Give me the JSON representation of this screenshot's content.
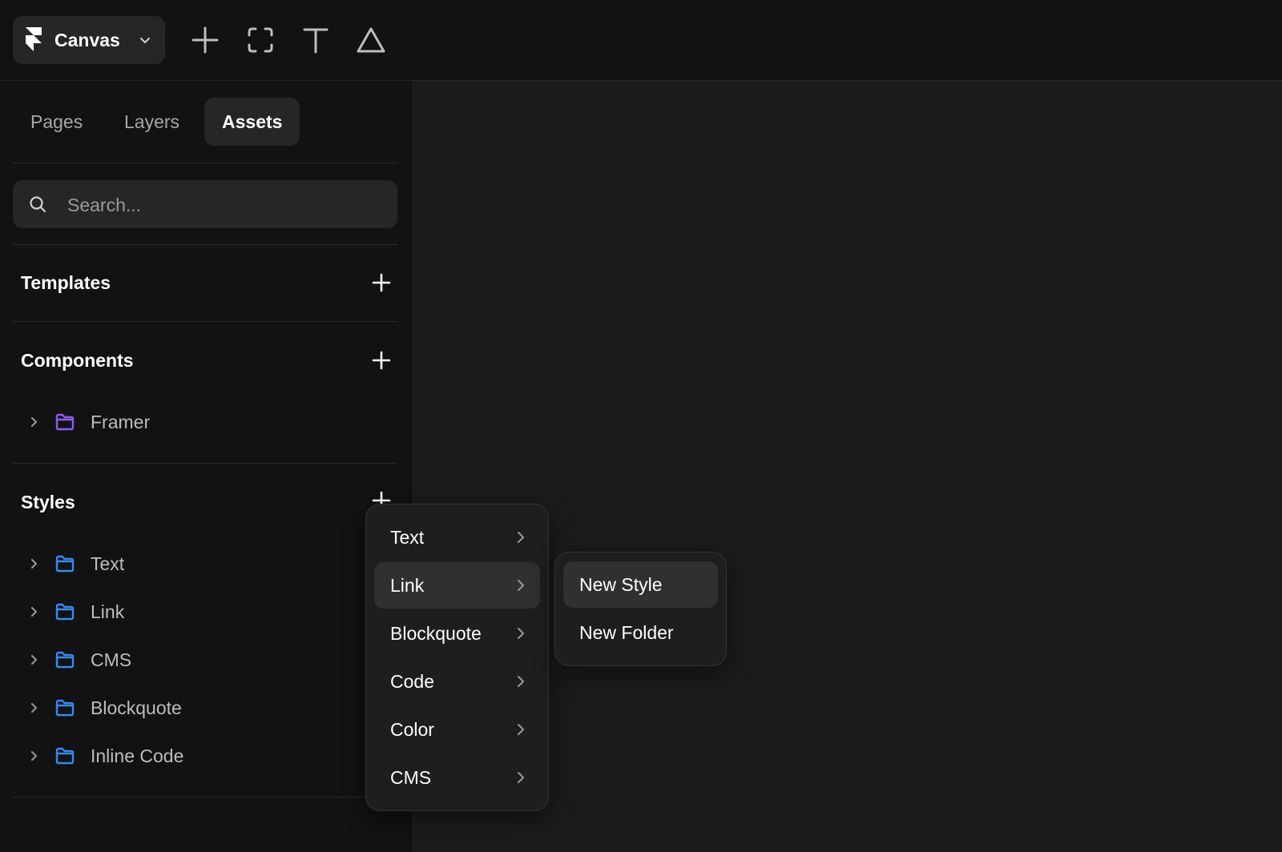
{
  "toolbar": {
    "project_name": "Canvas",
    "tools": [
      "plus-icon",
      "frame-icon",
      "text-icon",
      "shape-icon"
    ]
  },
  "sidebar": {
    "tabs": [
      {
        "label": "Pages",
        "active": false
      },
      {
        "label": "Layers",
        "active": false
      },
      {
        "label": "Assets",
        "active": true
      }
    ],
    "search": {
      "placeholder": "Search..."
    },
    "sections": {
      "templates": {
        "title": "Templates"
      },
      "components": {
        "title": "Components",
        "items": [
          {
            "label": "Framer",
            "icon": "folder-icon",
            "color": "#8b5cf6"
          }
        ]
      },
      "styles": {
        "title": "Styles",
        "items": [
          {
            "label": "Text",
            "icon": "folder-icon",
            "color": "#2f8cf5"
          },
          {
            "label": "Link",
            "icon": "folder-icon",
            "color": "#2f8cf5"
          },
          {
            "label": "CMS",
            "icon": "folder-icon",
            "color": "#2f8cf5"
          },
          {
            "label": "Blockquote",
            "icon": "folder-icon",
            "color": "#2f8cf5"
          },
          {
            "label": "Inline Code",
            "icon": "folder-icon",
            "color": "#2f8cf5"
          }
        ]
      }
    }
  },
  "context_menu": {
    "items": [
      {
        "label": "Text",
        "has_submenu": true,
        "highlighted": false
      },
      {
        "label": "Link",
        "has_submenu": true,
        "highlighted": true
      },
      {
        "label": "Blockquote",
        "has_submenu": true,
        "highlighted": false
      },
      {
        "label": "Code",
        "has_submenu": true,
        "highlighted": false
      },
      {
        "label": "Color",
        "has_submenu": true,
        "highlighted": false
      },
      {
        "label": "CMS",
        "has_submenu": true,
        "highlighted": false
      }
    ]
  },
  "submenu": {
    "items": [
      {
        "label": "New Style",
        "highlighted": true
      },
      {
        "label": "New Folder",
        "highlighted": false
      }
    ]
  },
  "colors": {
    "accent_folder": "#2f8cf5",
    "component_folder": "#8b5cf6",
    "background": "#121212",
    "canvas": "#1b1b1b"
  }
}
